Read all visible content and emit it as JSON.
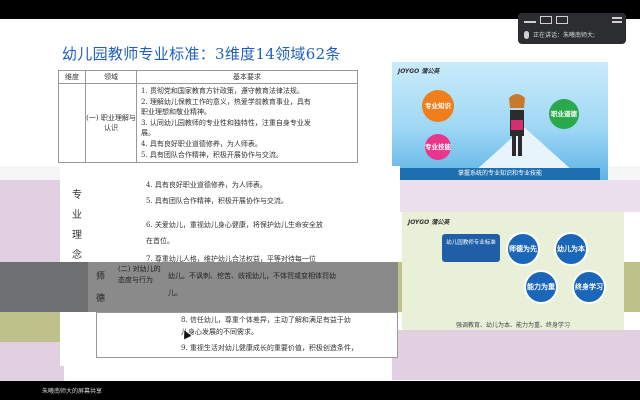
{
  "meeting": {
    "speaking_label": "正在讲话：朱曦南师大;"
  },
  "slide": {
    "title": "幼儿园教师专业标准：3维度14领域62条"
  },
  "table": {
    "headers": {
      "dimension": "维度",
      "domain": "领域",
      "requirements": "基本要求"
    },
    "dimension": "专业理念与师德",
    "domain1": "(一) 职业理解与认识",
    "domain2": "(二) 对幼儿的态度与行为",
    "req_lines_1": [
      "1. 贯彻党和国家教育方针政策，遵守教育法律法规。",
      "2. 理解幼儿保教工作的意义，热爱学前教育事业，具有",
      "职业理想和敬业精神。",
      "3. 认同幼儿园教师的专业性和独特性，注重自身专业发",
      "展。",
      "4. 具有良好职业道德修养，为人师表。",
      "5. 具有团队合作精神，积极开展协作与交流。"
    ],
    "req_lines_2": [
      "6. 关爱幼儿，重视幼儿身心健康，将保护幼儿生命安全放",
      "在首位。",
      "7. 尊重幼儿人格，维护幼儿合法权益，平等对待每一位",
      "幼儿。不讽刺、挖苦、歧视幼儿，不体罚或变相体罚幼",
      "儿。",
      "8. 信任幼儿，尊重个体差异，主动了解和满足有益于幼",
      "儿身心发展的不同需求。",
      "9. 重视生活对幼儿健康成长的重要价值，积极创造条件，"
    ],
    "overlay_vertical": "专业理念与",
    "overlay_dim": "师德"
  },
  "image1": {
    "logo": "JOYGO 蒲公英",
    "bubbles": [
      "专业知识",
      "专业技能",
      "职业道德"
    ],
    "caption": "掌握系统的专业知识和专业技能"
  },
  "image2": {
    "logo": "JOYGO 蒲公英",
    "center_text": "幼儿园教师专业标准",
    "circles": [
      "师德为先",
      "幼儿为本",
      "能力为重",
      "终身学习"
    ],
    "caption": "强调教育、幼儿为本、能力为重、终身学习"
  },
  "share": {
    "label": "朱曦南师大的屏幕共享"
  }
}
